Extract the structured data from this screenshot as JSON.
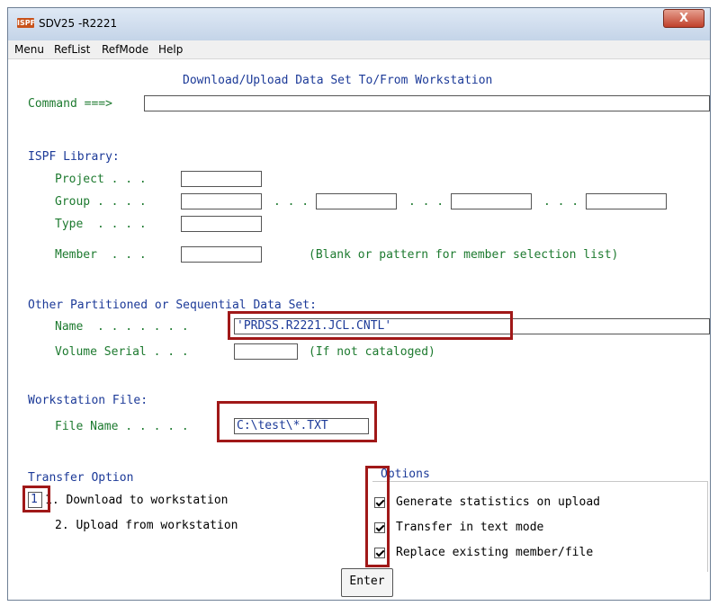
{
  "window": {
    "app_icon_text": "ISPF",
    "title": "SDV25 -R2221",
    "close_glyph": "X"
  },
  "menubar": {
    "items": [
      "Menu",
      "RefList",
      "RefMode",
      "Help"
    ]
  },
  "panel": {
    "title": "Download/Upload Data Set To/From Workstation",
    "command_label": "Command ===>",
    "command_value": ""
  },
  "ispf_library": {
    "heading": "ISPF Library:",
    "project_label": "Project . . .",
    "group_label": "Group . . . .",
    "group_dots": [
      ". . .",
      ". . .",
      ". . ."
    ],
    "type_label": "Type  . . . .",
    "member_label": "Member  . . .",
    "member_hint": "(Blank or pattern for member selection list)",
    "project_value": "",
    "group_values": [
      "",
      "",
      "",
      ""
    ],
    "type_value": "",
    "member_value": ""
  },
  "other_dataset": {
    "heading": "Other Partitioned or Sequential Data Set:",
    "name_label": "Name  . . . . . . .",
    "name_value": "'PRDSS.R2221.JCL.CNTL'",
    "volume_label": "Volume Serial . . .",
    "volume_value": "",
    "volume_hint": "(If not cataloged)"
  },
  "workstation": {
    "heading": "Workstation File:",
    "file_label": "File Name . . . . .",
    "file_value": "C:\\test\\*.TXT"
  },
  "transfer": {
    "heading": "Transfer Option",
    "selected_value": "1",
    "option1": "1. Download to workstation",
    "option2": "2. Upload from workstation"
  },
  "options": {
    "heading": "Options",
    "items": [
      {
        "label": "Generate statistics on upload",
        "checked": true
      },
      {
        "label": "Transfer in text mode",
        "checked": true
      },
      {
        "label": "Replace existing member/file",
        "checked": true
      }
    ]
  },
  "enter_label": "Enter",
  "colors": {
    "text_blue": "#1c3a98",
    "text_green": "#1d7a2f",
    "highlight_red": "#a01818"
  }
}
